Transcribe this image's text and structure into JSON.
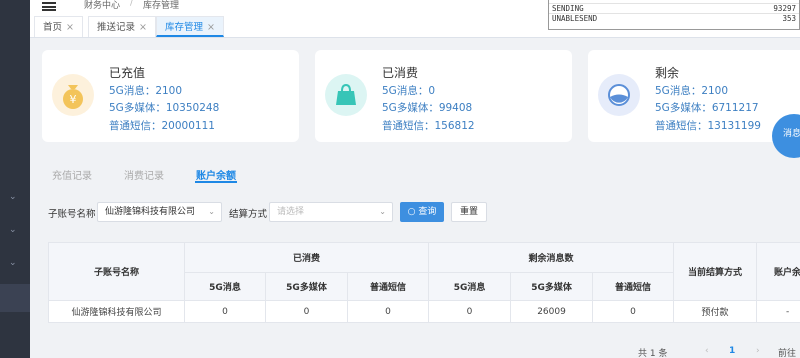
{
  "topbar": {
    "crumb1": "财务中心",
    "sep": "/",
    "crumb2": "库存管理"
  },
  "tabs": [
    {
      "label": "首页",
      "close": "×"
    },
    {
      "label": "推送记录",
      "close": "×"
    },
    {
      "label": "库存管理",
      "close": "×"
    }
  ],
  "console": [
    {
      "key": "SENDING",
      "val": "93297"
    },
    {
      "key": "UNABLESEND",
      "val": "353"
    }
  ],
  "cards": [
    {
      "title": "已充值",
      "icon": "money-bag-icon",
      "lines": [
        "5G消息：2100",
        "5G多媒体：10350248",
        "普通短信：20000111"
      ]
    },
    {
      "title": "已消费",
      "icon": "shopping-bag-icon",
      "lines": [
        "5G消息：0",
        "5G多媒体：99408",
        "普通短信：156812"
      ]
    },
    {
      "title": "剩余",
      "icon": "remaining-icon",
      "lines": [
        "5G消息：2100",
        "5G多媒体：6711217",
        "普通短信：13131199"
      ]
    }
  ],
  "fab_label": "消息",
  "subtabs": [
    "充值记录",
    "消费记录",
    "账户余额"
  ],
  "filters": {
    "account_label": "子账号名称",
    "account_value": "仙游隆锦科技有限公司",
    "method_label": "结算方式",
    "method_placeholder": "请选择",
    "search_label": "查询",
    "reset_label": "重置"
  },
  "table": {
    "h_account": "子账号名称",
    "h_consumed": "已消费",
    "h_remaining": "剩余消息数",
    "h_method": "当前结算方式",
    "h_balance": "账户余",
    "sub": [
      "5G消息",
      "5G多媒体",
      "普通短信",
      "5G消息",
      "5G多媒体",
      "普通短信"
    ],
    "rows": [
      {
        "account": "仙游隆锦科技有限公司",
        "c5g": "0",
        "cmm": "0",
        "csms": "0",
        "r5g": "0",
        "rmm": "26009",
        "rsms": "0",
        "method": "预付款",
        "balance": "-"
      }
    ]
  },
  "pager": {
    "total": "共 1 条",
    "prev": "‹",
    "page": "1",
    "next": "›",
    "goto": "前往"
  },
  "colors": {
    "accent": "#1e88e5",
    "sidebar": "#2e3440",
    "value_text": "#3d7fc2"
  }
}
